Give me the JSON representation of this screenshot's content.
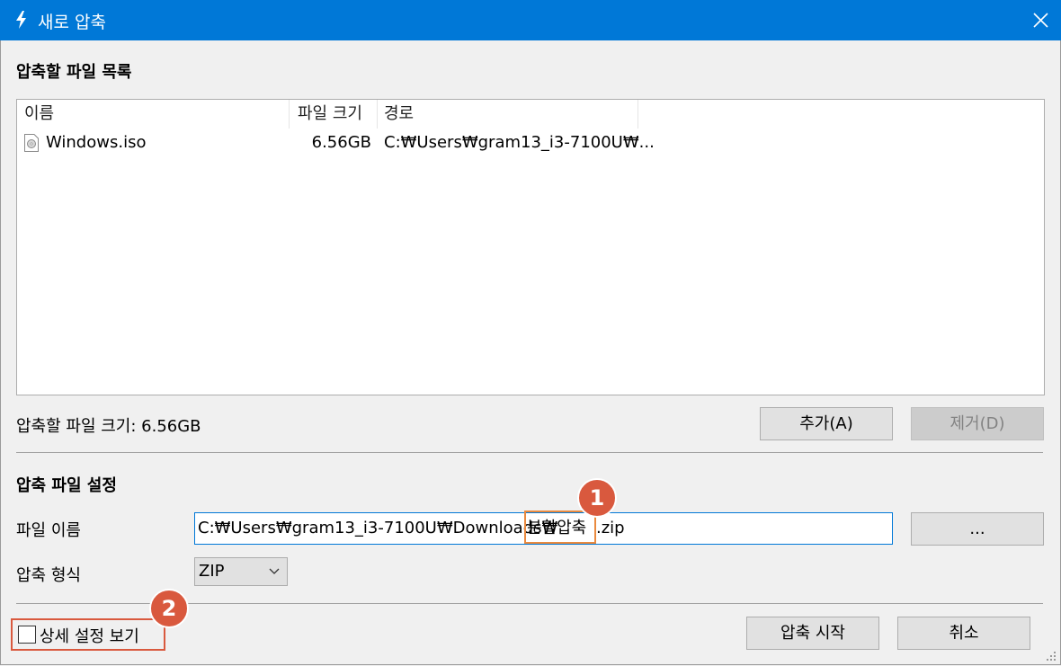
{
  "window": {
    "title": "새로 압축",
    "close_icon": "close-icon"
  },
  "file_list": {
    "section_title": "압축할 파일 목록",
    "columns": [
      "이름",
      "파일 크기",
      "경로"
    ],
    "rows": [
      {
        "name": "Windows.iso",
        "size": "6.56GB",
        "path": "C:₩Users₩gram13_i3-7100U₩..."
      }
    ],
    "total_label": "압축할 파일 크기: 6.56GB",
    "add_button": "추가(A)",
    "remove_button": "제거(D)"
  },
  "settings": {
    "section_title": "압축 파일 설정",
    "filename_label": "파일 이름",
    "filename_prefix": "C:₩Users₩gram13_i3-7100U₩Downloads₩",
    "filename_highlight": "분할압축",
    "filename_suffix": ".zip",
    "browse_button": "...",
    "format_label": "압축 형식",
    "format_value": "ZIP"
  },
  "footer": {
    "detail_checkbox_label": "상세 설정 보기",
    "start_button": "압축 시작",
    "cancel_button": "취소"
  },
  "annotations": {
    "badge1": "1",
    "badge2": "2",
    "highlight_color": "#ea8a3f",
    "badge_color": "#d9593e"
  },
  "colors": {
    "titlebar": "#0078d7"
  }
}
